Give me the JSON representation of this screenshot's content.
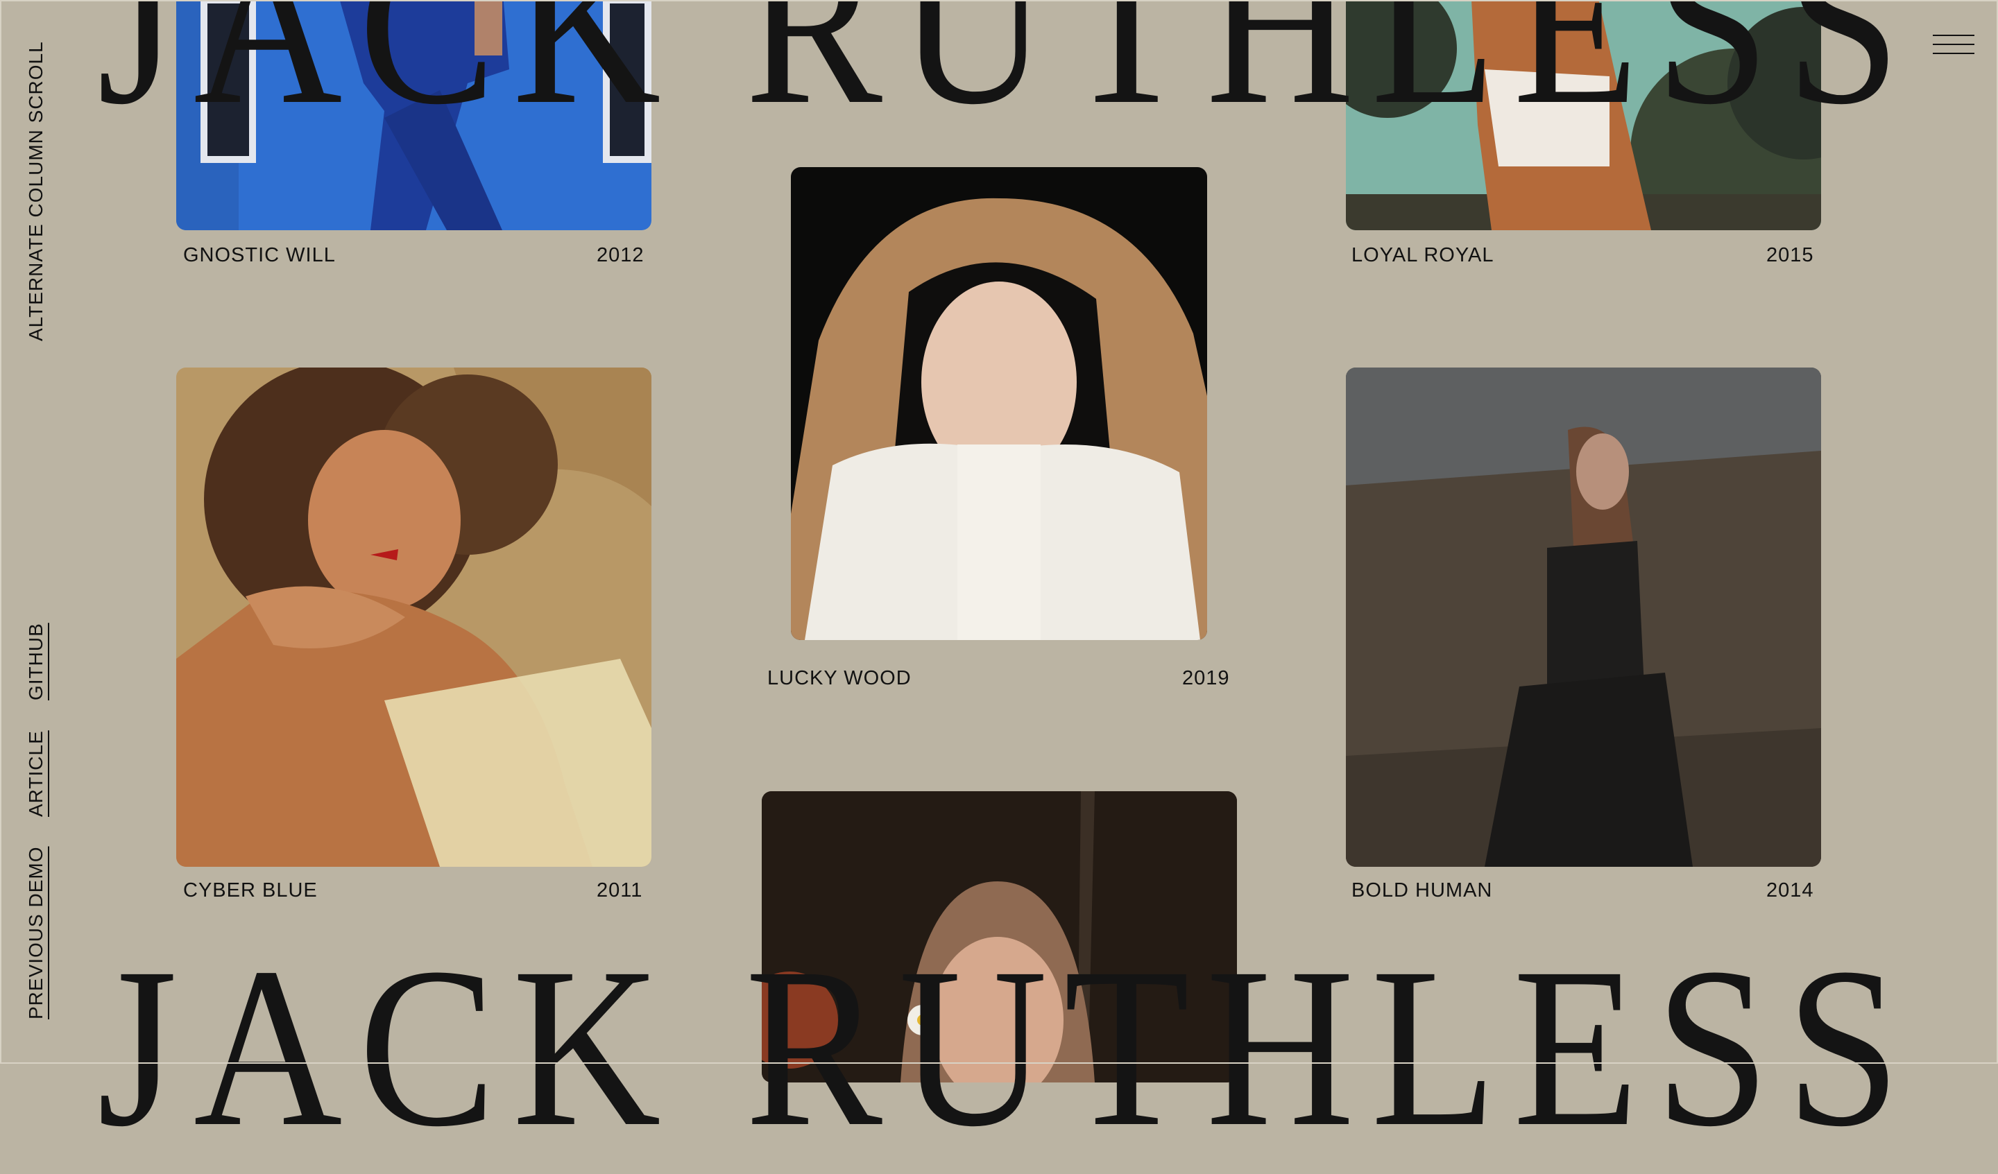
{
  "title_text": "JACK RUTHLESS",
  "sidebar": {
    "scroll_label": "ALTERNATE COLUMN SCROLL",
    "links": [
      "GITHUB",
      "ARTICLE",
      "PREVIOUS DEMO"
    ]
  },
  "menu": {
    "icon": "hamburger-menu-icon"
  },
  "gallery": [
    {
      "name": "GNOSTIC WILL",
      "year": "2012",
      "image": "man-in-blue-suit-walking-photo"
    },
    {
      "name": "LOYAL ROYAL",
      "year": "2015",
      "image": "woman-outdoors-teal-toned-photo"
    },
    {
      "name": "LUCKY WOOD",
      "year": "2019",
      "image": "woman-with-tan-coat-over-head-photo"
    },
    {
      "name": "CYBER BLUE",
      "year": "2011",
      "image": "curly-haired-woman-resting-head-photo"
    },
    {
      "name": "BOLD HUMAN",
      "year": "2014",
      "image": "woman-in-black-dress-field-photo"
    },
    {
      "name": "",
      "year": "",
      "image": "girl-with-flower-in-hair-photo"
    }
  ],
  "colors": {
    "background": "#bbb4a3",
    "text": "#111111"
  }
}
